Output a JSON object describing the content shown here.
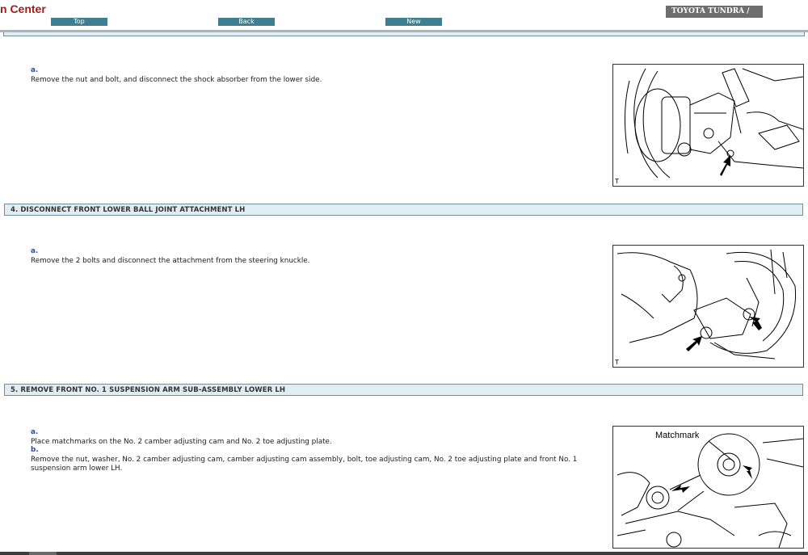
{
  "header": {
    "site_title": "n Center",
    "nav": {
      "top": "Top",
      "back": "Back",
      "new": "New"
    },
    "vehicle": "TOYOTA TUNDRA /"
  },
  "sections": [
    {
      "heading": "",
      "steps": [
        {
          "label": "a.",
          "text": "Remove the nut and bolt, and disconnect the shock absorber from the lower side."
        }
      ],
      "illustration": {
        "corner": "T",
        "callout": ""
      }
    },
    {
      "heading": "4. DISCONNECT FRONT LOWER BALL JOINT ATTACHMENT LH",
      "steps": [
        {
          "label": "a.",
          "text": "Remove the 2 bolts and disconnect the attachment from the steering knuckle."
        }
      ],
      "illustration": {
        "corner": "T",
        "callout": ""
      }
    },
    {
      "heading": "5. REMOVE FRONT NO. 1 SUSPENSION ARM SUB-ASSEMBLY LOWER LH",
      "steps": [
        {
          "label": "a.",
          "text": "Place matchmarks on the No. 2 camber adjusting cam and No. 2 toe adjusting plate."
        },
        {
          "label": "b.",
          "text": "Remove the nut, washer, No. 2 camber adjusting cam, camber adjusting cam assembly, bolt, toe adjusting cam, No. 2 toe adjusting plate and front No. 1 suspension arm lower LH."
        }
      ],
      "illustration": {
        "corner": "",
        "callout": "Matchmark"
      }
    }
  ],
  "colors": {
    "title_red": "#a01c1c",
    "nav_teal": "#3d7f91",
    "section_bg": "#e0edf2",
    "vehicle_bg": "#6e6e6e"
  }
}
